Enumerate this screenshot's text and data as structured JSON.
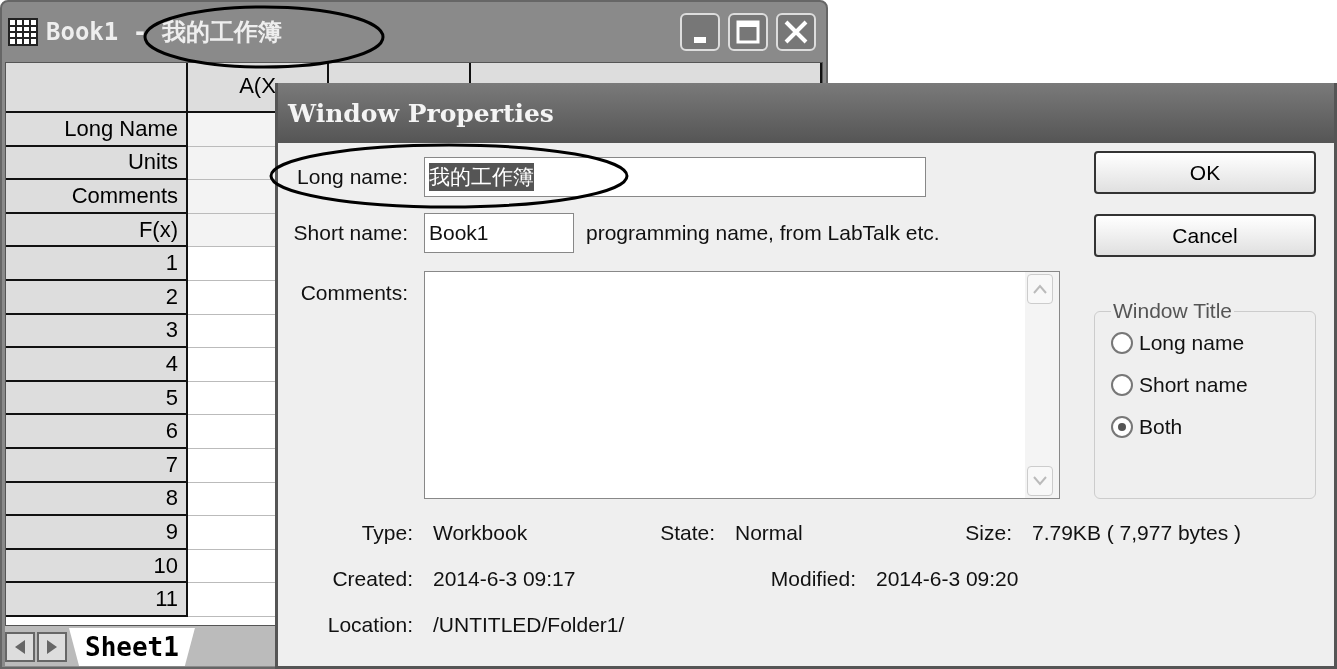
{
  "workbook_window": {
    "title": "Book1 - 我的工作簿",
    "columns": [
      "A(X"
    ],
    "row_labels": [
      "Long Name",
      "Units",
      "Comments",
      "F(x)",
      "1",
      "2",
      "3",
      "4",
      "5",
      "6",
      "7",
      "8",
      "9",
      "10",
      "11"
    ],
    "sheet_tabs": [
      {
        "label": "Sheet1",
        "selected": true
      }
    ]
  },
  "dialog": {
    "title": "Window Properties",
    "long_name": {
      "label": "Long name:",
      "value": "我的工作簿",
      "value_selected": true
    },
    "short_name": {
      "label": "Short name:",
      "value": "Book1",
      "hint": "programming name, from LabTalk etc."
    },
    "comments": {
      "label": "Comments:"
    },
    "buttons": [
      "OK",
      "Cancel"
    ],
    "window_title_group": {
      "title": "Window Title",
      "options": [
        {
          "label": "Long name",
          "selected": false
        },
        {
          "label": "Short name",
          "selected": false
        },
        {
          "label": "Both",
          "selected": true
        }
      ]
    },
    "info": [
      {
        "label": "Type:",
        "value": "Workbook"
      },
      {
        "label": "State:",
        "value": "Normal"
      },
      {
        "label": "Size:",
        "value": "7.79KB ( 7,977 bytes )"
      },
      {
        "label": "Created:",
        "value": "2014-6-3 09:17"
      },
      {
        "label": "Modified:",
        "value": "2014-6-3 09:20"
      },
      {
        "label": "Location:",
        "value": "/UNTITLED/Folder1/"
      }
    ]
  }
}
